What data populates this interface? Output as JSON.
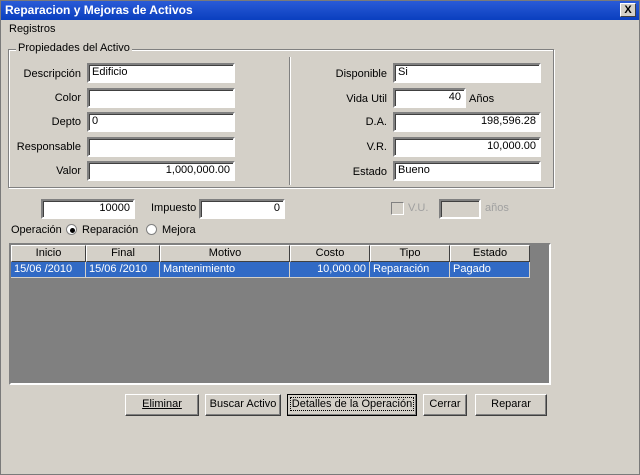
{
  "window": {
    "title": "Reparacion y Mejoras de Activos",
    "close_label": "X"
  },
  "menu": {
    "items": [
      "Registros"
    ]
  },
  "props": {
    "group_title": "Propiedades del Activo",
    "descripcion_label": "Descripción",
    "descripcion_value": "Edificio",
    "color_label": "Color",
    "color_value": "",
    "depto_label": "Depto",
    "depto_value": "0",
    "responsable_label": "Responsable",
    "responsable_value": "",
    "valor_label": "Valor",
    "valor_value": "1,000,000.00",
    "disponible_label": "Disponible",
    "disponible_value": "Si",
    "vida_util_label": "Vida Util",
    "vida_util_value": "40",
    "vida_util_unit": "Años",
    "da_label": "D.A.",
    "da_value": "198,596.28",
    "vr_label": "V.R.",
    "vr_value": "10,000.00",
    "estado_label": "Estado",
    "estado_value": "Bueno"
  },
  "operation": {
    "amount_value": "10000",
    "impuesto_label": "Impuesto",
    "impuesto_value": "0",
    "vu_label": "V.U.",
    "vu_value": "",
    "anios_label": "años",
    "operacion_label": "Operación",
    "reparacion_label": "Reparación",
    "mejora_label": "Mejora",
    "selected": "Reparación"
  },
  "table": {
    "headers": [
      "Inicio",
      "Final",
      "Motivo",
      "Costo",
      "Tipo",
      "Estado"
    ],
    "rows": [
      [
        "15/06 /2010",
        "15/06 /2010",
        "Mantenimiento",
        "10,000.00",
        "Reparación",
        "Pagado"
      ]
    ]
  },
  "buttons": {
    "eliminar": "Eliminar",
    "buscar": "Buscar Activo",
    "detalles": "Detalles de la Operación",
    "cerrar": "Cerrar",
    "reparar": "Reparar"
  },
  "colors": {
    "titlebar": "#0a3fbf",
    "selection": "#316ac5",
    "window_bg": "#d4d0c8",
    "grid_bg": "#808080"
  }
}
